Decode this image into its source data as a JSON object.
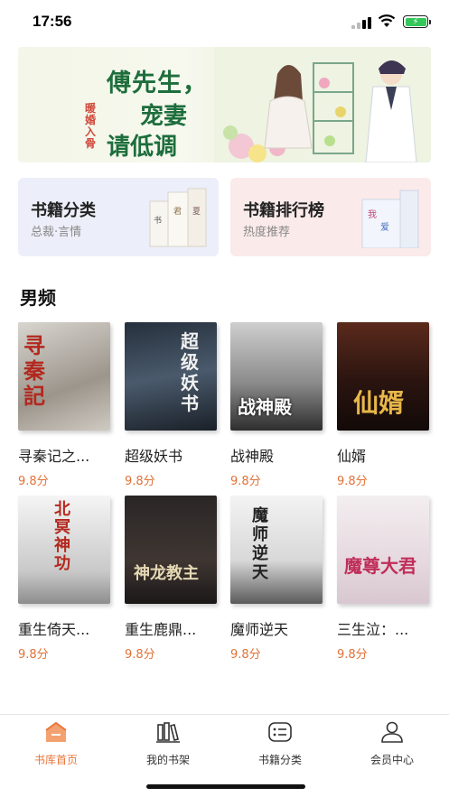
{
  "status_bar": {
    "time": "17:56"
  },
  "banner": {
    "line1": "傅先生，",
    "line2": "宠妻",
    "line3": "请低调",
    "tag": "暖婚入骨"
  },
  "cards": [
    {
      "title": "书籍分类",
      "subtitle": "总裁·言情"
    },
    {
      "title": "书籍排行榜",
      "subtitle": "热度推荐"
    }
  ],
  "section": {
    "title": "男频"
  },
  "books": [
    {
      "name": "寻秦记之...",
      "score": "9.8分",
      "cover_text": "寻秦記"
    },
    {
      "name": "超级妖书",
      "score": "9.8分",
      "cover_text": "超级妖书"
    },
    {
      "name": "战神殿",
      "score": "9.8分",
      "cover_text": "战神殿"
    },
    {
      "name": "仙婿",
      "score": "9.8分",
      "cover_text": "仙婿"
    },
    {
      "name": "重生倚天...",
      "score": "9.8分",
      "cover_text": "北冥神功"
    },
    {
      "name": "重生鹿鼎...",
      "score": "9.8分",
      "cover_text": "神龙教主"
    },
    {
      "name": "魔师逆天",
      "score": "9.8分",
      "cover_text": "魔师逆天"
    },
    {
      "name": "三生泣：...",
      "score": "9.8分",
      "cover_text": "魔尊大君"
    }
  ],
  "tabbar": [
    {
      "label": "书库首页",
      "icon": "home-icon",
      "active": true
    },
    {
      "label": "我的书架",
      "icon": "bookshelf-icon",
      "active": false
    },
    {
      "label": "书籍分类",
      "icon": "category-icon",
      "active": false
    },
    {
      "label": "会员中心",
      "icon": "user-icon",
      "active": false
    }
  ],
  "colors": {
    "accent": "#e8763b",
    "banner_text": "#1d6e3c"
  }
}
